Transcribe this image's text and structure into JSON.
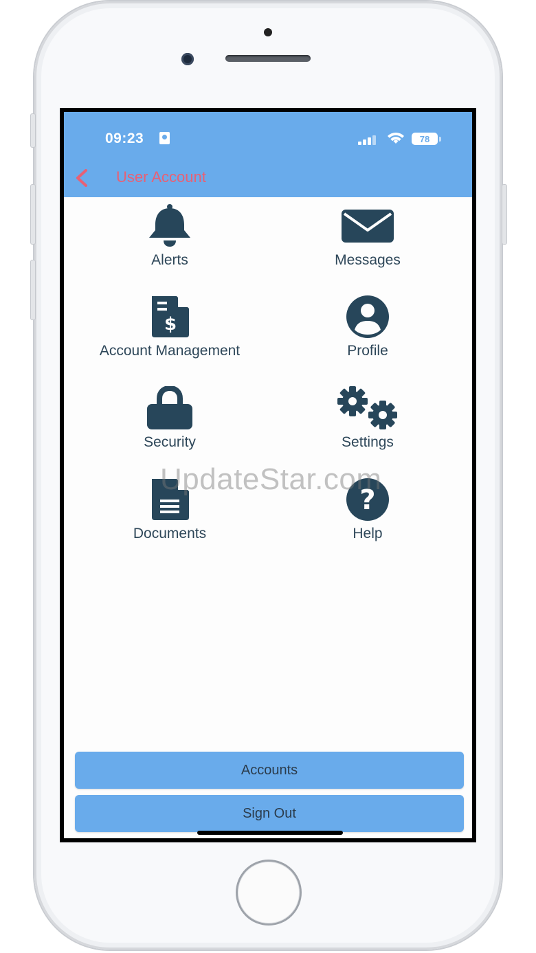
{
  "status_bar": {
    "time": "09:23",
    "battery": "78"
  },
  "nav": {
    "title": "User Account"
  },
  "menu": [
    {
      "label": "Alerts",
      "icon": "bell-icon"
    },
    {
      "label": "Messages",
      "icon": "envelope-icon"
    },
    {
      "label": "Account Management",
      "icon": "invoice-dollar-icon"
    },
    {
      "label": "Profile",
      "icon": "user-circle-icon"
    },
    {
      "label": "Security",
      "icon": "lock-icon"
    },
    {
      "label": "Settings",
      "icon": "gears-icon"
    },
    {
      "label": "Documents",
      "icon": "document-icon"
    },
    {
      "label": "Help",
      "icon": "question-circle-icon"
    }
  ],
  "watermark": "UpdateStar.com",
  "buttons": {
    "accounts": "Accounts",
    "sign_out": "Sign Out"
  },
  "colors": {
    "header": "#69abeb",
    "icon": "#27465a",
    "title": "#e86074",
    "button": "#69abeb"
  }
}
